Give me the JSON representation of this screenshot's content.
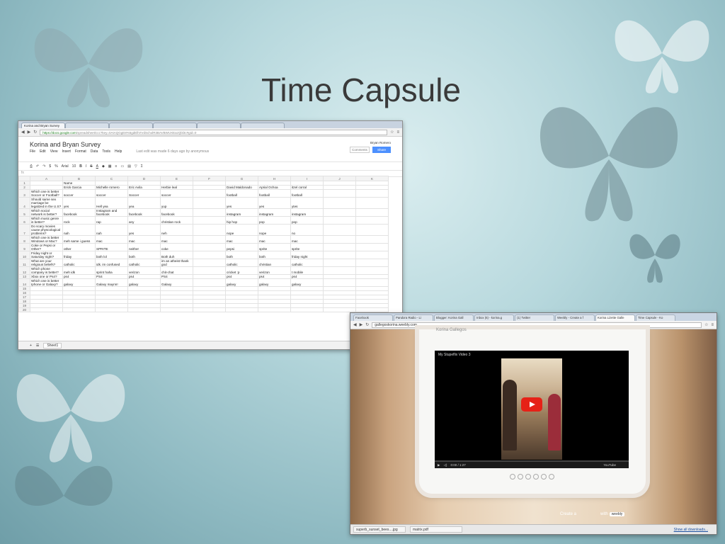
{
  "slide": {
    "title": "Time Capsule"
  },
  "sheet_window": {
    "tab_title": "Korina and Bryan Survey",
    "url_secure": "https://docs.google.com",
    "url_rest": "/spreadsheet/ccc?key=0AtAQGgE8%5gdEllVIVdScholR3BAVBWUXEazQbl3c#gid=0",
    "doc_title": "Korina and Bryan Survey",
    "menus": [
      "File",
      "Edit",
      "View",
      "Insert",
      "Format",
      "Data",
      "Tools",
      "Help"
    ],
    "last_edit": "Last edit was made 6 days ago by anonymous",
    "user": "Bryan Romero",
    "comments_label": "Comments",
    "share_label": "Share",
    "font_name": "Arial",
    "font_size": "10",
    "fx": "fx",
    "columns": [
      "",
      "A",
      "B",
      "C",
      "D",
      "E",
      "F",
      "G",
      "H",
      "I",
      "J",
      "K"
    ],
    "rows": [
      [
        "1",
        "",
        "Name",
        "",
        "",
        "",
        "",
        "",
        "",
        "",
        "",
        ""
      ],
      [
        "2",
        "",
        "Erick Garcia",
        "Michelle romero",
        "Eric Avila",
        "Herbie leal",
        "",
        "David Maldonado",
        "Aprial Ochoa",
        "itzel corral",
        "",
        ""
      ],
      [
        "3",
        "Which one is better Soccer or Football?",
        "soccer",
        "soccer",
        "Soccer",
        "soccer",
        "",
        "football",
        "football",
        "football",
        "",
        ""
      ],
      [
        "4",
        "Should same sex marriage be legalized in the U.S?",
        "yes",
        "Hell yea",
        "yea",
        "yup",
        "",
        "yes",
        "yes",
        "ytes",
        "",
        ""
      ],
      [
        "5",
        "Which social network is better?",
        "facebook",
        "Instagram and facebook",
        "facebook",
        "facebook",
        "",
        "instagram",
        "instagram",
        "instagram",
        "",
        ""
      ],
      [
        "6",
        "Which music genre is better?",
        "rock",
        "rap",
        "any",
        "christian rock",
        "",
        "hip hop",
        "pop",
        "pop",
        "",
        ""
      ],
      [
        "7",
        "Do scary movies cause physcological problems?",
        "nah",
        "nah",
        "yes",
        "neh",
        "",
        "nope",
        "nope",
        "no",
        "",
        ""
      ],
      [
        "8",
        "Which one is better Windows or Mac?",
        "meh same i guess",
        "mac",
        "mac",
        "mac",
        "",
        "mac",
        "mac",
        "mac",
        "",
        ""
      ],
      [
        "9",
        "Coke or Pepsi or Other?",
        "other",
        "SPRITE",
        "neither",
        "coke",
        "",
        "pepsi",
        "sprite",
        "sprite",
        "",
        ""
      ],
      [
        "10",
        "Friday night or Saturday night?",
        "friday",
        "both lol",
        "both",
        "Both duh",
        "",
        "both",
        "both",
        "friday night",
        "",
        ""
      ],
      [
        "11",
        "What are your religious beliefs?",
        "catholic",
        "idk. im confused",
        "catholic",
        "im an atheist thank god",
        "",
        "catholic",
        "christian",
        "catholic",
        "",
        ""
      ],
      [
        "12",
        "Which phone company is better?",
        "meh idk",
        "sprint haha",
        "verizon",
        "chit-chat",
        "",
        "cricket :p",
        "verizon",
        "t mobile",
        "",
        ""
      ],
      [
        "13",
        "Xbox one or Ps4?",
        "ps4",
        "PS4",
        "ps4",
        "PS4",
        "",
        "ps4",
        "ps4",
        "ps4",
        "",
        ""
      ],
      [
        "14",
        "Which one is better Iphone or Galaxy?",
        "galaxy",
        "Galaxy maynn!",
        "galaxy",
        "Galaxy",
        "",
        "galaxy",
        "galaxy",
        "galaxy",
        "",
        ""
      ],
      [
        "15",
        "",
        "",
        "",
        "",
        "",
        "",
        "",
        "",
        "",
        "",
        ""
      ],
      [
        "16",
        "",
        "",
        "",
        "",
        "",
        "",
        "",
        "",
        "",
        "",
        ""
      ],
      [
        "17",
        "",
        "",
        "",
        "",
        "",
        "",
        "",
        "",
        "",
        "",
        ""
      ],
      [
        "18",
        "",
        "",
        "",
        "",
        "",
        "",
        "",
        "",
        "",
        "",
        ""
      ],
      [
        "19",
        "",
        "",
        "",
        "",
        "",
        "",
        "",
        "",
        "",
        "",
        ""
      ],
      [
        "20",
        "",
        "",
        "",
        "",
        "",
        "",
        "",
        "",
        "",
        "",
        ""
      ]
    ],
    "sheet_tab": "Sheet1"
  },
  "video_window": {
    "tabs": [
      "Facebook",
      "Pandora Radio - Li",
      "Blogger: Korina Gall",
      "Inbox (6) - korina.g",
      "(1) Twitter",
      "Weebly - Create a f",
      "Korina Lizette Galle",
      "Time Capsule - Ko"
    ],
    "url": "gallegoskorina.weebly.com",
    "site_name": "Korina Gallegos",
    "video_title": "My Stupeflix Video 3",
    "time": "0:00 / 1:27",
    "youtube_label": "YouTube",
    "create_text": "Create a",
    "create_with": "with",
    "weebly_label": "weebly",
    "downloads": [
      "superb_sunset_bees....jpg",
      "matrix.pdf"
    ],
    "show_all": "Show all downloads..."
  },
  "colors": {
    "background": "#a9cfd5",
    "share_button": "#4d90fe",
    "play_button": "#e62117"
  }
}
